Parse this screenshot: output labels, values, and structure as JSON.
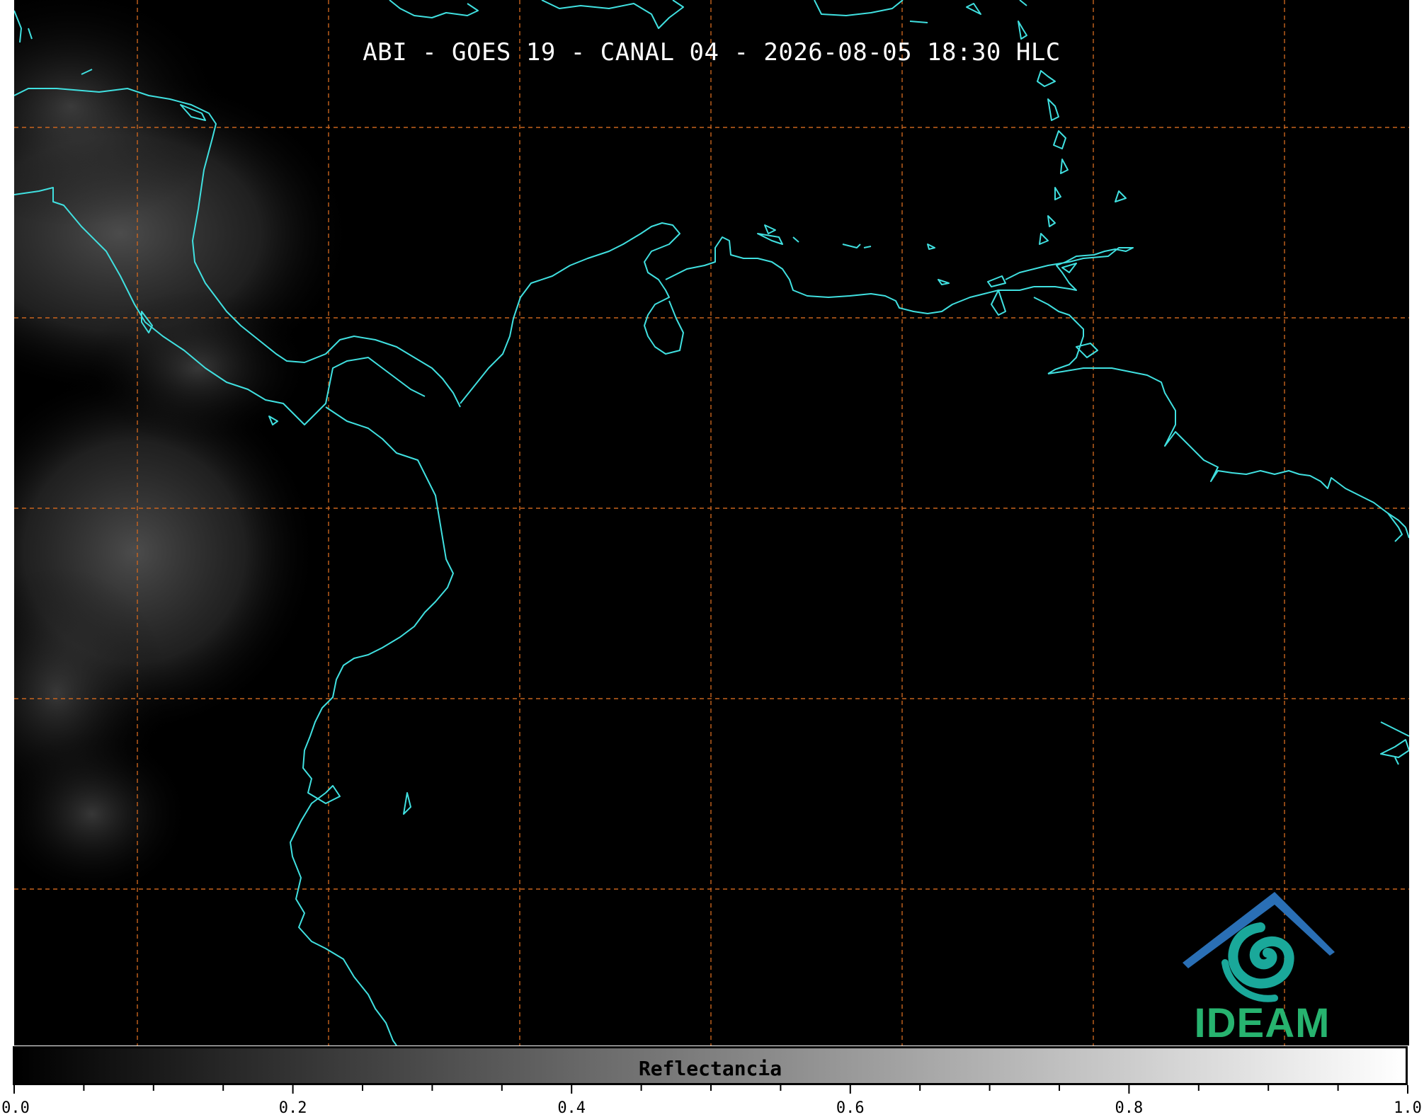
{
  "title": "ABI - GOES 19 - CANAL 04 - 2026-08-05 18:30 HLC",
  "map": {
    "background": "#000000",
    "coastline_color": "#40e0e0",
    "graticule_color": "#c8641e",
    "graticule_style": "dashed",
    "cloud_color": "#bfbfbf"
  },
  "logo": {
    "text": "IDEAM",
    "colors": [
      "#2a6fb5",
      "#1aa89a",
      "#27b36f"
    ]
  },
  "colorbar": {
    "label": "Reflectancia",
    "range": [
      0.0,
      1.0
    ],
    "gradient": [
      "#000000",
      "#ffffff"
    ],
    "tick_labels": [
      "0.0",
      "0.2",
      "0.4",
      "0.6",
      "0.8",
      "1.0"
    ],
    "major_ticks": [
      0.0,
      0.2,
      0.4,
      0.6,
      0.8,
      1.0
    ],
    "minor_step": 0.05
  }
}
